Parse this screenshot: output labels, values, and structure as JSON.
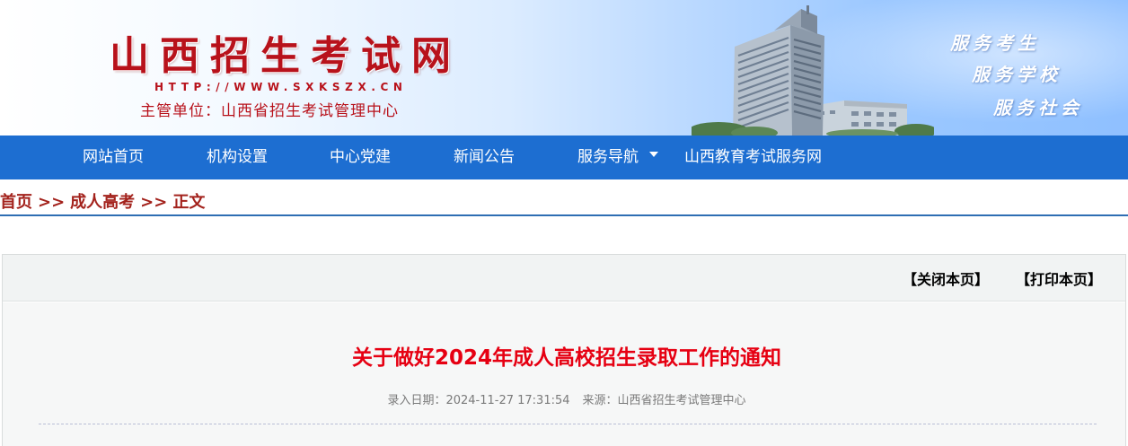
{
  "header": {
    "title": "山西招生考试网",
    "url": "HTTP://WWW.SXKSZX.CN",
    "organizer": "主管单位：山西省招生考试管理中心",
    "slogans": [
      "服务考生",
      "服务学校",
      "服务社会"
    ]
  },
  "nav": {
    "items": [
      "网站首页",
      "机构设置",
      "中心党建",
      "新闻公告",
      "服务导航",
      "山西教育考试服务网"
    ]
  },
  "breadcrumb": {
    "items": [
      "首页",
      "成人高考",
      "正文"
    ],
    "separator": ">>"
  },
  "toolbar": {
    "close_label": "【关闭本页】",
    "print_label": "【打印本页】"
  },
  "article": {
    "title": "关于做好2024年成人高校招生录取工作的通知",
    "date_label": "录入日期：",
    "date": "2024-11-27 17:31:54",
    "source_label": "来源：",
    "source": "山西省招生考试管理中心"
  },
  "colors": {
    "brand_red": "#b8121b",
    "nav_blue": "#1d6ed1",
    "breadcrumb_red": "#a3221c",
    "title_red": "#e60012"
  }
}
